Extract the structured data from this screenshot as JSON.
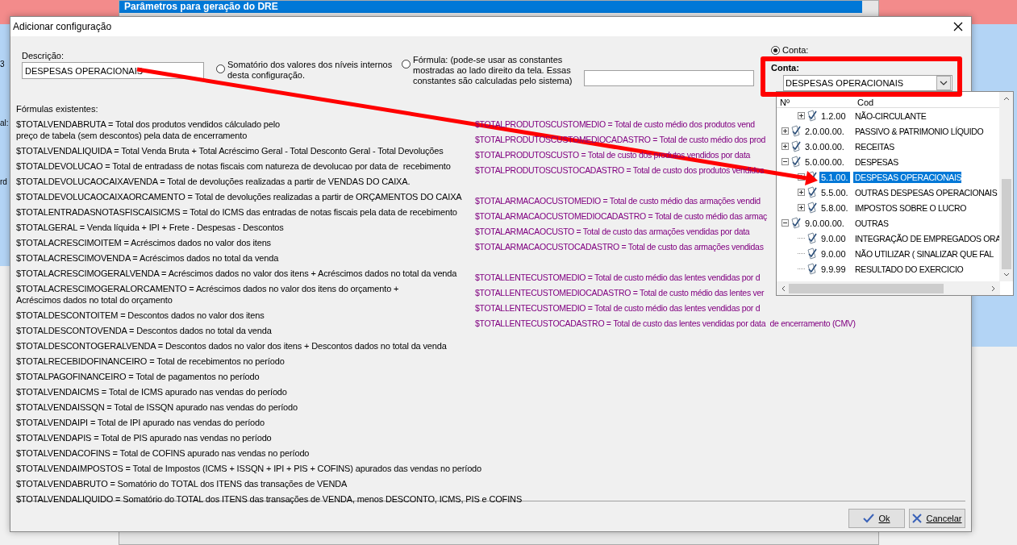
{
  "parent_window": {
    "title": "Parâmetros para geração do DRE",
    "edge_texts": [
      "3",
      "al:",
      "rd"
    ]
  },
  "dialog": {
    "title": "Adicionar configuração",
    "description": {
      "label": "Descrição:",
      "value": "DESPESAS OPERACIONAIS"
    },
    "options": [
      {
        "kind": "plain",
        "label": "Somatório dos valores dos níveis internos\ndesta configuração.",
        "selected": false
      },
      {
        "kind": "formula",
        "label": "Fórmula: (pode-se usar as constantes\nmostradas ao lado direito da tela. Essas\nconstantes são calculadas pelo sistema)",
        "selected": false
      },
      {
        "kind": "account",
        "label": "Conta:",
        "selected": true
      }
    ],
    "account": {
      "label": "Conta:",
      "value": "DESPESAS OPERACIONAIS"
    },
    "formulas_label": "Fórmulas existentes:",
    "formulas_left": [
      "$TOTALVENDABRUTA = Total dos produtos vendidos cálculado pelo\npreço de tabela (sem descontos) pela data de encerramento",
      "$TOTALVENDALIQUIDA = Total Venda Bruta + Total Acréscimo Geral - Total Desconto Geral - Total Devoluções",
      "$TOTALDEVOLUCAO = Total de entradass de notas fiscais com natureza de devolucao por data de  recebimento",
      "$TOTALDEVOLUCAOCAIXAVENDA = Total de devoluções realizadas a partir de VENDAS DO CAIXA.",
      "$TOTALDEVOLUCAOCAIXAORCAMENTO = Total de devoluções realizadas a partir de ORÇAMENTOS DO CAIXA",
      "$TOTALENTRADASNOTASFISCAISICMS = Total do ICMS das entradas de notas fiscais pela data de recebimento",
      "$TOTALGERAL = Venda líquida + IPI + Frete - Despesas - Descontos",
      "$TOTALACRESCIMOITEM = Acréscimos dados no valor dos itens",
      "$TOTALACRESCIMOVENDA = Acréscimos dados no total da venda",
      "$TOTALACRESCIMOGERALVENDA = Acréscimos dados no valor dos itens + Acréscimos dados no total da venda",
      "$TOTALACRESCIMOGERALORCAMENTO = Acréscimos dados no valor dos itens do orçamento +\nAcréscimos dados no total do orçamento",
      "$TOTALDESCONTOITEM = Descontos dados no valor dos itens",
      "$TOTALDESCONTOVENDA = Descontos dados no total da venda",
      "$TOTALDESCONTOGERALVENDA = Descontos dados no valor dos itens + Descontos dados no total da venda",
      "$TOTALRECEBIDOFINANCEIRO = Total de recebimentos no período",
      "$TOTALPAGOFINANCEIRO = Total de pagamentos no período",
      "$TOTALVENDAICMS = Total de ICMS apurado nas vendas do período",
      "$TOTALVENDAISSQN = Total de ISSQN apurado nas vendas do período",
      "$TOTALVENDAIPI = Total de IPI apurado nas vendas do período",
      "$TOTALVENDAPIS = Total de PIS apurado nas vendas no período",
      "$TOTALVENDACOFINS = Total de COFINS apurado nas vendas no período",
      "$TOTALVENDAIMPOSTOS = Total de Impostos (ICMS + ISSQN + IPI + PIS + COFINS) apurados das vendas no período",
      "$TOTALVENDABRUTO = Somatório do TOTAL dos ITENS das transações de VENDA",
      "$TOTALVENDALIQUIDO = Somatório do TOTAL dos ITENS das transações de VENDA, menos DESCONTO, ICMS, PIS e COFINS"
    ],
    "formulas_right": [
      [
        "$TOTALPRODUTOSCUSTOMEDIO = Total de custo médio dos produtos vend",
        "$TOTALPRODUTOSCUSTOMEDIOCADASTRO = Total de custo médio dos prod",
        "$TOTALPRODUTOSCUSTO = Total de custo dos produtos vendidos por data",
        "$TOTALPRODUTOSCUSTOCADASTRO = Total de custo dos produtos vendidos"
      ],
      [
        "$TOTALARMACAOCUSTOMEDIO = Total de custo médio das armações vendid",
        "$TOTALARMACAOCUSTOMEDIOCADASTRO = Total de custo médio das armaç",
        "$TOTALARMACAOCUSTO = Total de custo das armações vendidas por data",
        "$TOTALARMACAOCUSTOCADASTRO = Total de custo das armações vendidas"
      ],
      [
        "$TOTALLENTECUSTOMEDIO = Total de custo médio das lentes vendidas por d",
        "$TOTALLENTECUSTOMEDIOCADASTRO = Total de custo médio das lentes ver",
        "$TOTALLENTECUSTOMEDIO = Total de custo médio das lentes vendidas por d",
        "$TOTALLENTECUSTOCADASTRO = Total de custo das lentes vendidas por data  de encerramento (CMV)"
      ]
    ],
    "account_tree": {
      "columns": [
        "Nº",
        "Cod"
      ],
      "items": [
        {
          "kind": "hidden",
          "children": [
            {
              "kind": "branch",
              "expanded": false,
              "number": "1.2.00",
              "name": "NÃO-CIRCULANTE",
              "selected": false
            }
          ]
        },
        {
          "kind": "branch",
          "expanded": false,
          "number": "2.0.00.00.",
          "name": "PASSIVO & PATRIMONIO LÍQUIDO",
          "selected": false
        },
        {
          "kind": "branch",
          "expanded": false,
          "number": "3.0.00.00.",
          "name": "RECEITAS",
          "selected": false
        },
        {
          "kind": "branch",
          "expanded": true,
          "number": "5.0.00.00.",
          "name": "DESPESAS",
          "selected": false,
          "children": [
            {
              "kind": "branch",
              "expanded": false,
              "number": "5.1.00.",
              "name": "DESPESAS OPERACIONAIS",
              "selected": true
            },
            {
              "kind": "branch",
              "expanded": false,
              "number": "5.5.00.",
              "name": "OUTRAS DESPESAS OPERACIONAIS",
              "selected": false
            },
            {
              "kind": "branch",
              "expanded": false,
              "number": "5.8.00.",
              "name": "IMPOSTOS SOBRE O LUCRO",
              "selected": false
            }
          ]
        },
        {
          "kind": "branch",
          "expanded": true,
          "number": "9.0.00.00.",
          "name": "OUTRAS",
          "selected": false,
          "children": [
            {
              "kind": "leaf",
              "number": "9.0.00",
              "name": "INTEGRAÇÃO DE EMPREGADOS ORA",
              "selected": false
            },
            {
              "kind": "leaf",
              "number": "9.0.00",
              "name": "NÃO UTILIZAR ( SINALIZAR QUE FAL",
              "selected": false
            },
            {
              "kind": "leaf",
              "number": "9.9.99",
              "name": "RESULTADO DO EXERCICIO",
              "selected": false
            }
          ]
        }
      ]
    },
    "buttons": [
      {
        "kind": "ok",
        "label": "Ok"
      },
      {
        "kind": "cancel",
        "label": "Cancelar"
      }
    ]
  }
}
